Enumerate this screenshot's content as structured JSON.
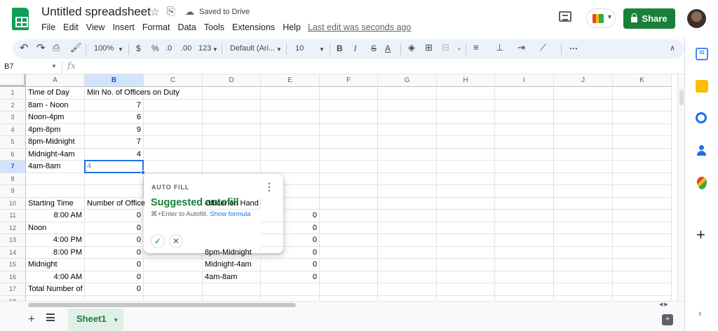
{
  "app": {
    "doc_title": "Untitled spreadsheet",
    "saved_status": "Saved to Drive",
    "last_edit": "Last edit was seconds ago",
    "share_label": "Share"
  },
  "menu": [
    "File",
    "Edit",
    "View",
    "Insert",
    "Format",
    "Data",
    "Tools",
    "Extensions",
    "Help"
  ],
  "toolbar": {
    "zoom": "100%",
    "currency": "$",
    "percent": "%",
    "decimal_decrease": ".0",
    "decimal_increase": ".00",
    "more_formats": "123",
    "font": "Default (Ari...",
    "font_size": "10",
    "bold": "B",
    "italic": "I",
    "strikethrough": "S",
    "text_color": "A",
    "more": "⋯"
  },
  "formula_bar": {
    "name_box": "B7",
    "fx": "fx"
  },
  "columns": [
    "A",
    "B",
    "C",
    "D",
    "E",
    "F",
    "G",
    "H",
    "I",
    "J",
    "K"
  ],
  "rows": [
    "1",
    "2",
    "3",
    "4",
    "5",
    "6",
    "7",
    "8",
    "9",
    "10",
    "11",
    "12",
    "13",
    "14",
    "15",
    "16",
    "17",
    "18"
  ],
  "cells": {
    "A1": "Time of Day",
    "B1": "Min No. of Officers on Duty",
    "A2": "8am - Noon",
    "B2": "7",
    "A3": "Noon-4pm",
    "B3": "6",
    "A4": "4pm-8pm",
    "B4": "9",
    "A5": "8pm-Midnight",
    "B5": "7",
    "A6": "Midnight-4am",
    "B6": "4",
    "A7": "4am-8am",
    "B7": "4",
    "A10": "Starting Time",
    "B10": "Number of Office",
    "D10": "Officer on Hand",
    "A11": "8:00 AM",
    "B11": "0",
    "E11": "0",
    "A12": "Noon",
    "B12": "0",
    "E12": "0",
    "A13": "4:00 PM",
    "B13": "0",
    "E13": "0",
    "A14": "8:00 PM",
    "B14": "0",
    "D14": "8pm-Midnight",
    "E14": "0",
    "A15": "Midnight",
    "B15": "0",
    "D15": "Midnight-4am",
    "E15": "0",
    "A16": "4:00 AM",
    "B16": "0",
    "D16": "4am-8am",
    "E16": "0",
    "A17": "Total Number of",
    "B17": "0"
  },
  "autofill": {
    "label": "AUTO FILL",
    "title": "Suggested autofill",
    "hint": "⌘+Enter to Autofill.",
    "link": "Show formula"
  },
  "sheet_tab": "Sheet1",
  "side_panel": {
    "calendar_day": "31"
  },
  "colors": {
    "accent_green": "#188038",
    "selection_blue": "#1a73e8"
  }
}
